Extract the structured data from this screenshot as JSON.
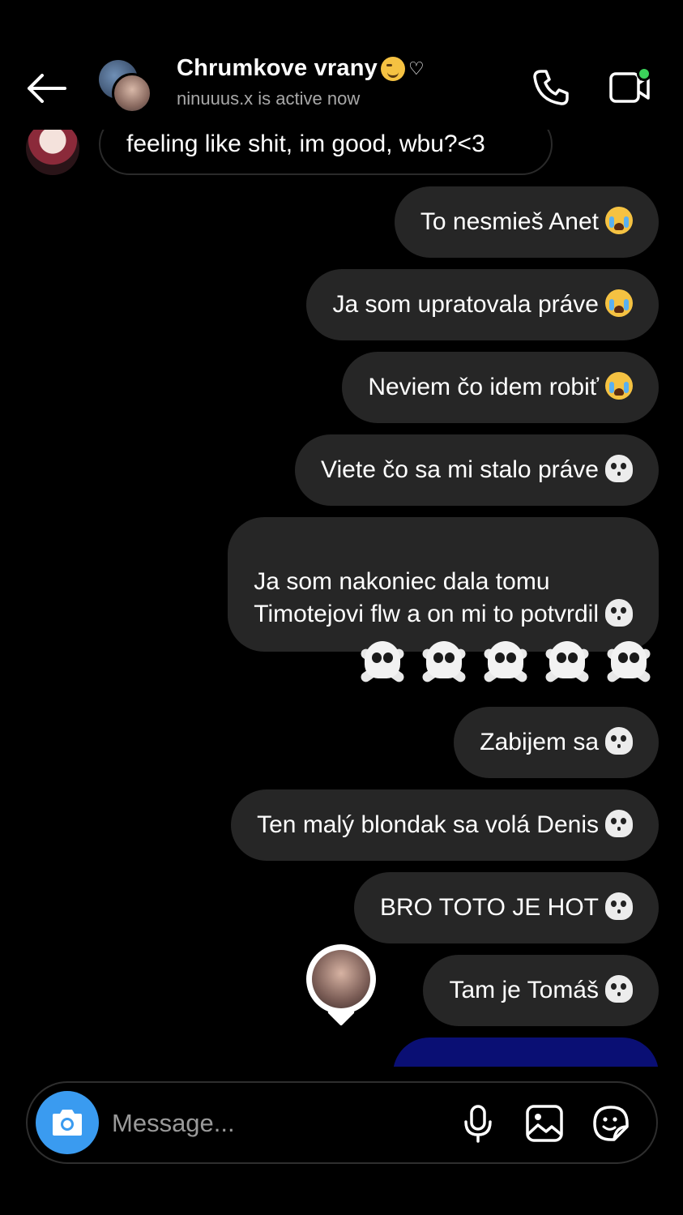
{
  "header": {
    "group_name": "Chrumkove vrany",
    "heart": "♡",
    "status": "ninuuus.x is active now"
  },
  "received": {
    "text": "feeling like shit, im good, wbu?<3"
  },
  "sent_messages": [
    {
      "text": "To nesmieš Anet",
      "emoji": "loudly-crying-face"
    },
    {
      "text": "Ja som upratovala práve",
      "emoji": "loudly-crying-face"
    },
    {
      "text": "Neviem čo idem robiť",
      "emoji": "loudly-crying-face"
    },
    {
      "text": "Viete čo sa mi stalo práve",
      "emoji": "skull-crossbones"
    },
    {
      "text": "Ja som nakoniec dala tomu\nTimotejovi flw a on mi to potvrdil",
      "emoji": "skull-crossbones"
    },
    {
      "text": "Zabijem sa",
      "emoji": "skull-crossbones"
    },
    {
      "text": "Ten malý blondak sa volá Denis",
      "emoji": "skull-crossbones"
    },
    {
      "text": "BRO TOTO JE HOT",
      "emoji": "skull-crossbones"
    },
    {
      "text": "Tam je Tomáš",
      "emoji": "skull-crossbones"
    }
  ],
  "big_skulls_count": 5,
  "composer": {
    "placeholder": "Message..."
  },
  "colors": {
    "background": "#000000",
    "bubble_sent": "#262626",
    "camera_button": "#3a9bf0",
    "active_dot": "#3bd15a",
    "blue_bubble": "#0a0f74"
  }
}
